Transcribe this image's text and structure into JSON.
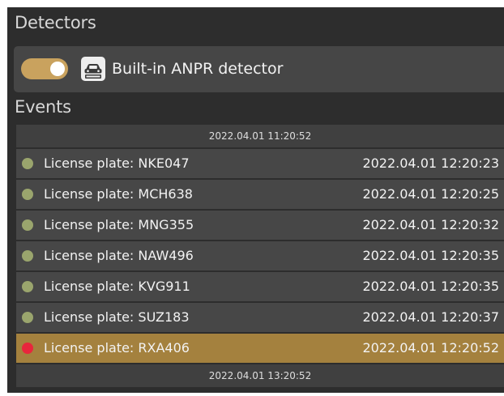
{
  "colors": {
    "panel_background": "#2d2d2d",
    "row_background": "#474747",
    "selected_row": "#a4813e",
    "toggle_on": "#c9a25e",
    "status_ok": "#9aa56d",
    "status_alert": "#e8263c"
  },
  "detectors": {
    "title": "Detectors",
    "items": [
      {
        "enabled": true,
        "icon": "anpr-camera-icon",
        "label": "Built-in ANPR detector"
      }
    ]
  },
  "events": {
    "title": "Events",
    "start_time": "2022.04.01 11:20:52",
    "end_time": "2022.04.01 13:20:52",
    "rows": [
      {
        "label": "License plate: NKE047",
        "time": "2022.04.01 12:20:23",
        "status": "ok",
        "selected": false
      },
      {
        "label": "License plate: MCH638",
        "time": "2022.04.01 12:20:25",
        "status": "ok",
        "selected": false
      },
      {
        "label": "License plate: MNG355",
        "time": "2022.04.01 12:20:32",
        "status": "ok",
        "selected": false
      },
      {
        "label": "License plate: NAW496",
        "time": "2022.04.01 12:20:35",
        "status": "ok",
        "selected": false
      },
      {
        "label": "License plate: KVG911",
        "time": "2022.04.01 12:20:35",
        "status": "ok",
        "selected": false
      },
      {
        "label": "License plate: SUZ183",
        "time": "2022.04.01 12:20:37",
        "status": "ok",
        "selected": false
      },
      {
        "label": "License plate: RXA406",
        "time": "2022.04.01 12:20:52",
        "status": "alert",
        "selected": true
      }
    ]
  }
}
